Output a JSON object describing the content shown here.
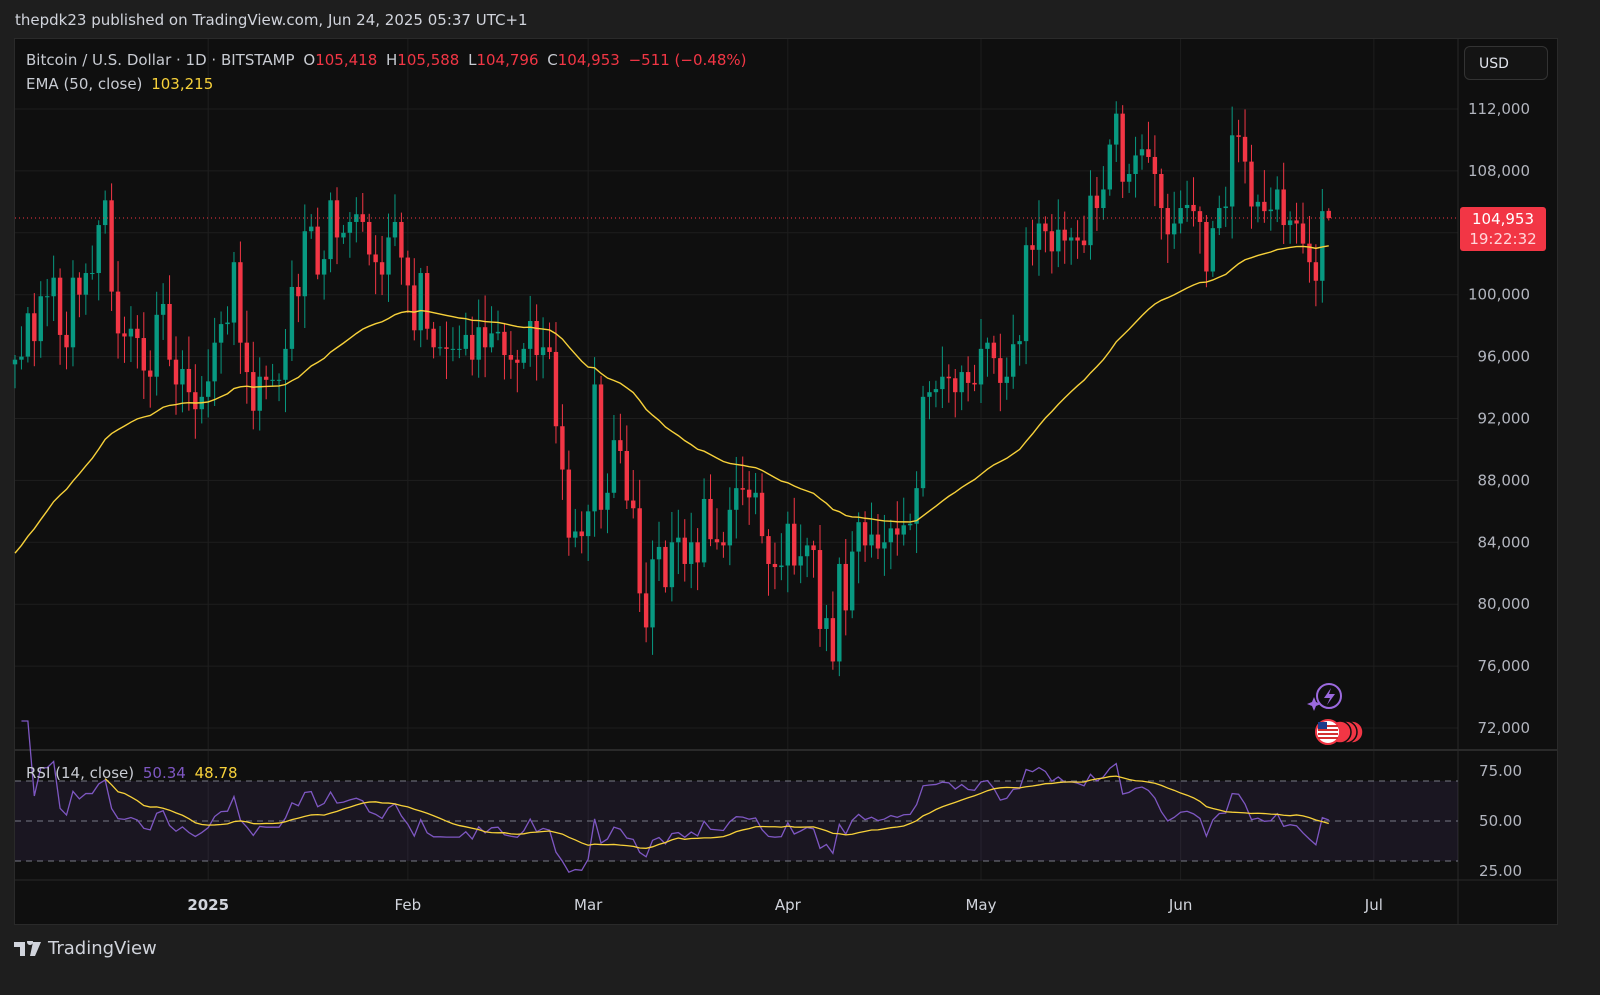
{
  "header": {
    "published": "thepdk23 published on TradingView.com, Jun 24, 2025 05:37 UTC+1"
  },
  "legend": {
    "symbol": "Bitcoin / U.S. Dollar · 1D · BITSTAMP",
    "o_label": "O",
    "o": "105,418",
    "h_label": "H",
    "h": "105,588",
    "l_label": "L",
    "l": "104,796",
    "c_label": "C",
    "c": "104,953",
    "change": "−511 (−0.48%)",
    "ema_label": "EMA (50, close)",
    "ema_value": "103,215",
    "rsi_label": "RSI (14, close)",
    "rsi_value": "50.34",
    "rsi_ma_value": "48.78"
  },
  "currency_button": "USD",
  "price_tag": {
    "price": "104,953",
    "countdown": "19:22:32"
  },
  "footer": {
    "brand": "TradingView"
  },
  "colors": {
    "up": "#089981",
    "down": "#f23645",
    "ema": "#f7d13a",
    "rsi": "#7e57c2",
    "rsi_ma": "#f7d13a",
    "background": "#0f0f0f"
  },
  "icons": [
    "lightning-sparkle-icon",
    "us-flag-events-icon",
    "tradingview-logo-icon"
  ],
  "chart_data": {
    "type": "candlestick",
    "start_date": "2024-12-02",
    "interval": "1D",
    "ylim": [
      70000,
      115000
    ],
    "y_ticks": [
      "112,000",
      "108,000",
      "104,000",
      "100,000",
      "96,000",
      "92,000",
      "88,000",
      "84,000",
      "80,000",
      "76,000",
      "72,000"
    ],
    "y_tick_values": [
      112000,
      108000,
      104000,
      100000,
      96000,
      92000,
      88000,
      84000,
      80000,
      76000,
      72000
    ],
    "x_ticks": [
      {
        "label": "2025",
        "date": "2025-01-01"
      },
      {
        "label": "Feb",
        "date": "2025-02-01"
      },
      {
        "label": "Mar",
        "date": "2025-03-01"
      },
      {
        "label": "Apr",
        "date": "2025-04-01"
      },
      {
        "label": "May",
        "date": "2025-05-01"
      },
      {
        "label": "Jun",
        "date": "2025-06-01"
      },
      {
        "label": "Jul",
        "date": "2025-07-01"
      }
    ],
    "last_candle": {
      "open": 105418,
      "high": 105588,
      "low": 104796,
      "close": 104953
    },
    "closes_thousands": [
      95.8,
      96.0,
      98.8,
      97.0,
      99.9,
      99.9,
      101.1,
      97.4,
      96.6,
      101.1,
      100.0,
      101.4,
      101.4,
      104.5,
      106.1,
      100.2,
      97.5,
      97.3,
      97.8,
      97.2,
      95.1,
      94.7,
      98.7,
      99.4,
      95.8,
      94.2,
      95.2,
      93.7,
      92.6,
      93.4,
      94.4,
      96.9,
      98.1,
      98.2,
      102.1,
      96.9,
      95.0,
      92.5,
      94.7,
      94.5,
      94.5,
      94.5,
      96.5,
      100.5,
      99.9,
      104.1,
      104.4,
      101.3,
      102.3,
      106.1,
      103.7,
      104.0,
      104.7,
      105.2,
      104.7,
      102.6,
      102.1,
      101.3,
      103.7,
      104.7,
      102.4,
      100.6,
      97.7,
      101.4,
      97.8,
      96.6,
      96.6,
      96.5,
      96.5,
      96.5,
      97.4,
      95.8,
      97.9,
      96.6,
      97.5,
      97.6,
      96.1,
      95.8,
      95.6,
      96.5,
      98.3,
      96.1,
      96.6,
      96.3,
      91.5,
      88.7,
      84.3,
      84.7,
      84.4,
      86.0,
      94.2,
      86.1,
      87.2,
      90.6,
      89.9,
      86.7,
      86.2,
      80.7,
      78.5,
      82.9,
      83.7,
      81.1,
      84.0,
      84.3,
      82.6,
      84.0,
      82.7,
      86.8,
      84.2,
      84.0,
      83.8,
      86.1,
      87.5,
      87.4,
      86.9,
      87.2,
      84.4,
      82.6,
      82.4,
      82.5,
      85.2,
      82.5,
      83.1,
      83.8,
      83.5,
      78.4,
      79.1,
      76.3,
      82.6,
      79.6,
      83.4,
      85.3,
      83.8,
      84.5,
      83.6,
      84.0,
      84.9,
      84.5,
      85.1,
      85.2,
      87.5,
      93.4,
      93.7,
      93.9,
      94.7,
      94.6,
      93.7,
      95.0,
      94.3,
      94.2,
      96.5,
      96.9,
      95.9,
      94.3,
      94.7,
      96.8,
      97.0,
      103.2,
      102.9,
      104.6,
      104.1,
      102.8,
      104.2,
      103.5,
      103.7,
      103.5,
      103.2,
      106.4,
      105.6,
      106.8,
      109.7,
      111.7,
      107.3,
      107.8,
      109.0,
      109.4,
      108.9,
      107.8,
      105.6,
      103.9,
      104.6,
      105.6,
      105.8,
      105.4,
      104.7,
      101.5,
      104.3,
      105.6,
      105.7,
      110.3,
      110.2,
      108.6,
      105.7,
      106.0,
      105.4,
      105.5,
      106.8,
      104.5,
      104.8,
      104.6,
      103.3,
      102.1,
      100.9,
      105.4,
      104.953
    ],
    "ema": {
      "period": 50,
      "last": 103215
    },
    "rsi": {
      "period": 14,
      "last": 50.34,
      "ma_last": 48.78,
      "ylim": [
        20,
        80
      ],
      "y_ticks": [
        "75.00",
        "50.00",
        "25.00"
      ],
      "y_tick_values": [
        75,
        50,
        25
      ],
      "band": [
        30,
        70
      ]
    }
  }
}
